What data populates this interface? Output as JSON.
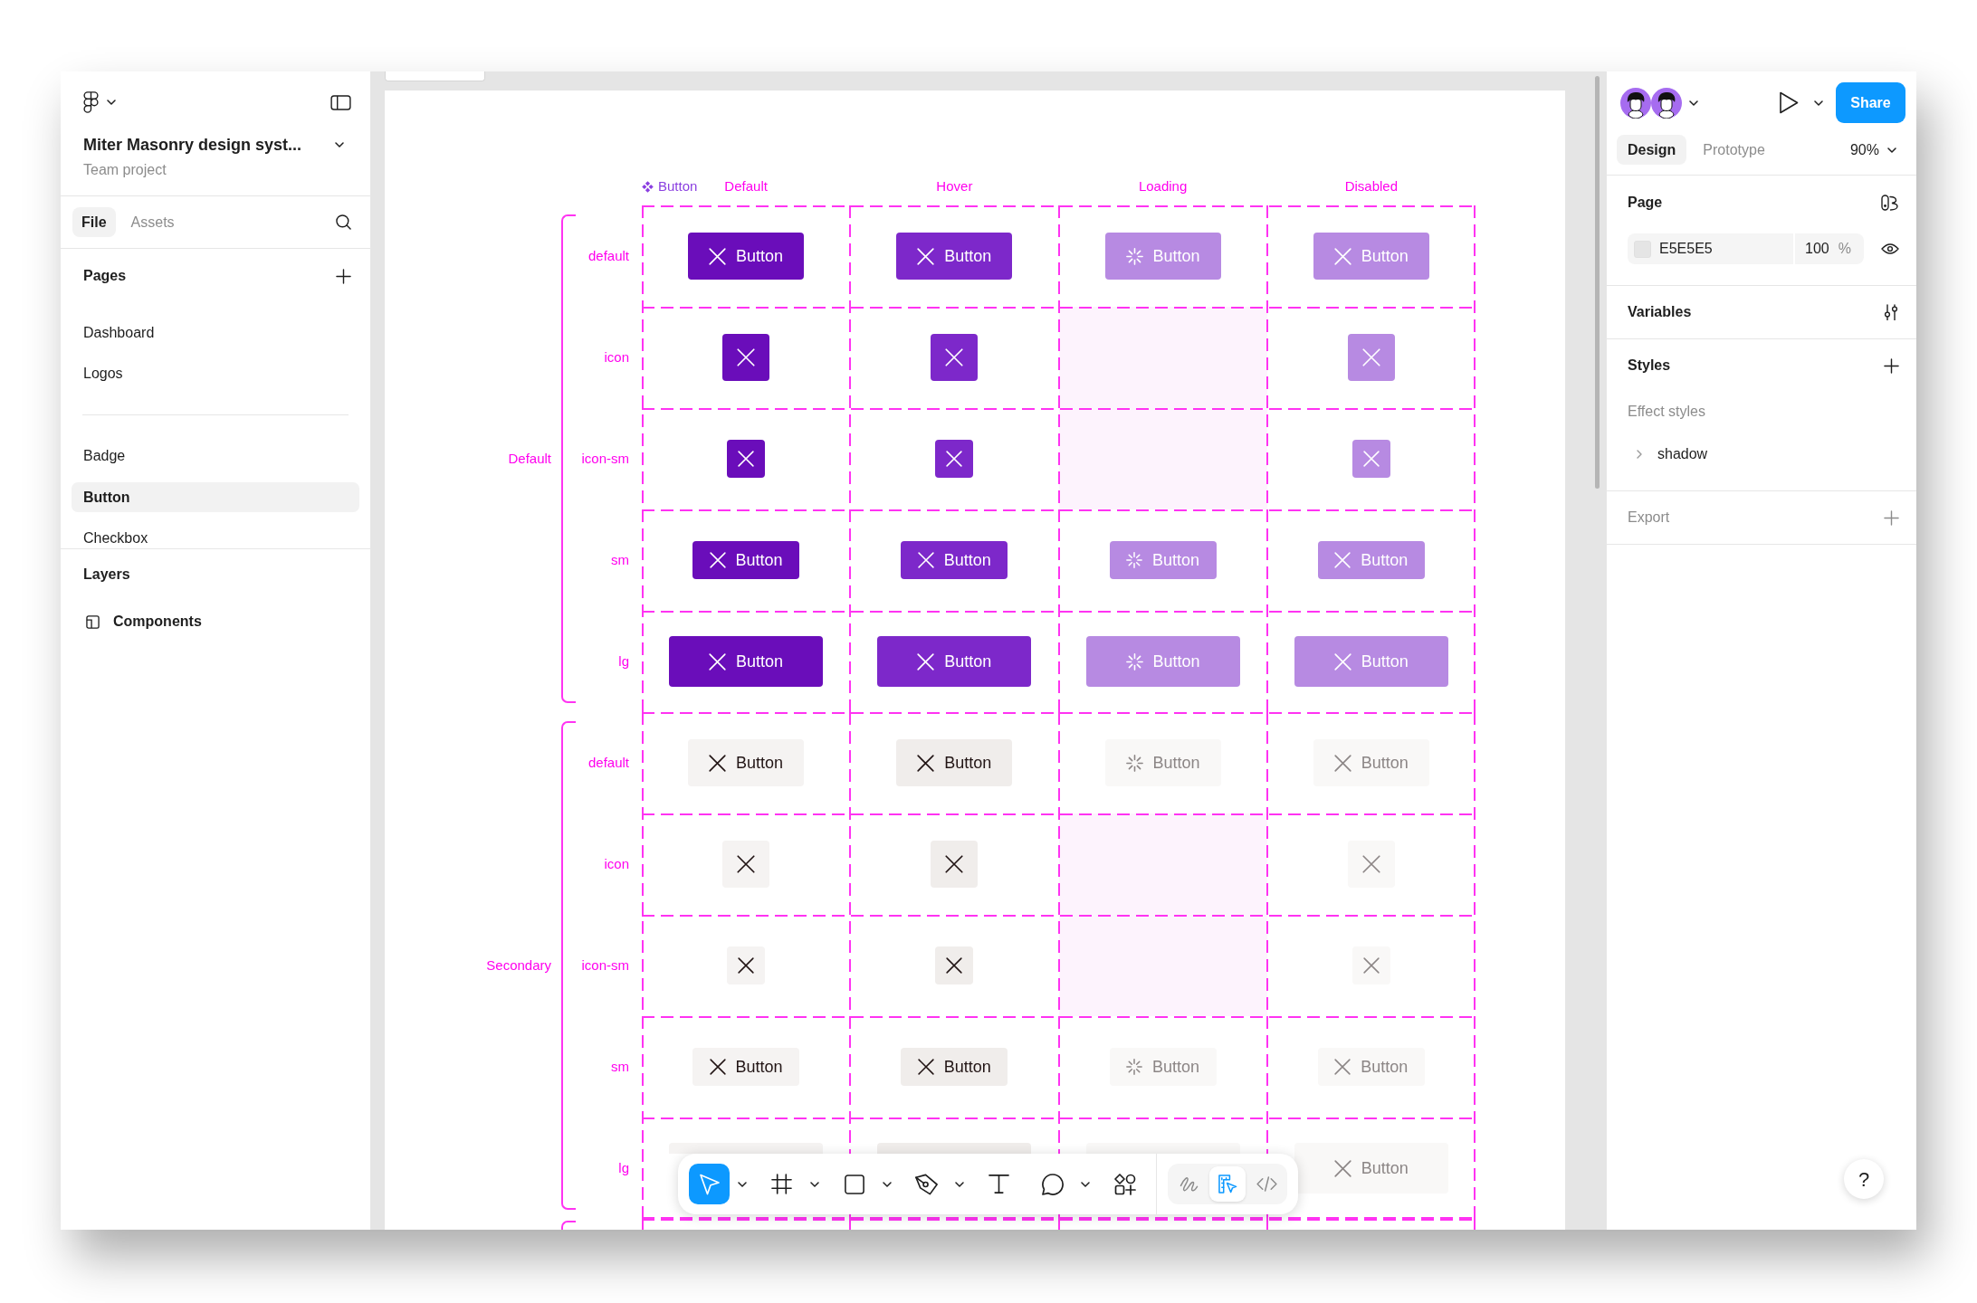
{
  "sidebar": {
    "title": "Miter Masonry design syst...",
    "subtitle": "Team project",
    "tabs": [
      {
        "label": "File",
        "selected": true
      },
      {
        "label": "Assets",
        "selected": false
      }
    ],
    "pages": {
      "title": "Pages",
      "items": [
        {
          "kind": "page",
          "label": "Dashboard",
          "selected": false
        },
        {
          "kind": "page",
          "label": "Logos",
          "selected": false
        },
        {
          "kind": "divider"
        },
        {
          "kind": "page",
          "label": "Badge",
          "selected": false
        },
        {
          "kind": "page",
          "label": "Button",
          "selected": true
        },
        {
          "kind": "page",
          "label": "Checkbox",
          "selected": false
        }
      ]
    },
    "layers": {
      "title": "Layers",
      "items": [
        {
          "label": "Components"
        }
      ]
    }
  },
  "canvas": {
    "component_label": "Button",
    "columns": [
      "Default",
      "Hover",
      "Loading",
      "Disabled"
    ],
    "groups": [
      {
        "label": "Default",
        "kind": "primary",
        "rows": [
          {
            "label": "default",
            "kind": "md",
            "cells": [
              {
                "kind": "default",
                "label": "Button"
              },
              {
                "kind": "hover",
                "label": "Button"
              },
              {
                "kind": "loading",
                "label": "Button"
              },
              {
                "kind": "disabled",
                "label": "Button"
              }
            ]
          },
          {
            "label": "icon",
            "kind": "icon",
            "cells": [
              {
                "kind": "default"
              },
              {
                "kind": "hover"
              },
              {
                "kind": "empty"
              },
              {
                "kind": "disabled"
              }
            ]
          },
          {
            "label": "icon-sm",
            "kind": "iconsm",
            "cells": [
              {
                "kind": "default"
              },
              {
                "kind": "hover"
              },
              {
                "kind": "empty"
              },
              {
                "kind": "disabled"
              }
            ]
          },
          {
            "label": "sm",
            "kind": "sm",
            "cells": [
              {
                "kind": "default",
                "label": "Button"
              },
              {
                "kind": "hover",
                "label": "Button"
              },
              {
                "kind": "loading",
                "label": "Button"
              },
              {
                "kind": "disabled",
                "label": "Button"
              }
            ]
          },
          {
            "label": "lg",
            "kind": "lg",
            "cells": [
              {
                "kind": "default",
                "label": "Button"
              },
              {
                "kind": "hover",
                "label": "Button"
              },
              {
                "kind": "loading",
                "label": "Button"
              },
              {
                "kind": "disabled",
                "label": "Button"
              }
            ]
          }
        ]
      },
      {
        "label": "Secondary",
        "kind": "secondary",
        "rows": [
          {
            "label": "default",
            "kind": "md",
            "cells": [
              {
                "kind": "default",
                "label": "Button"
              },
              {
                "kind": "hover",
                "label": "Button"
              },
              {
                "kind": "loading",
                "label": "Button"
              },
              {
                "kind": "disabled",
                "label": "Button"
              }
            ]
          },
          {
            "label": "icon",
            "kind": "icon",
            "cells": [
              {
                "kind": "default"
              },
              {
                "kind": "hover"
              },
              {
                "kind": "empty"
              },
              {
                "kind": "disabled"
              }
            ]
          },
          {
            "label": "icon-sm",
            "kind": "iconsm",
            "cells": [
              {
                "kind": "default"
              },
              {
                "kind": "hover"
              },
              {
                "kind": "empty"
              },
              {
                "kind": "disabled"
              }
            ]
          },
          {
            "label": "sm",
            "kind": "sm",
            "cells": [
              {
                "kind": "default",
                "label": "Button"
              },
              {
                "kind": "hover",
                "label": "Button"
              },
              {
                "kind": "loading",
                "label": "Button"
              },
              {
                "kind": "disabled",
                "label": "Button"
              }
            ]
          },
          {
            "label": "lg",
            "kind": "lg",
            "cells": [
              {
                "kind": "default"
              },
              {
                "kind": "hover"
              },
              {
                "kind": "loading"
              },
              {
                "kind": "disabled",
                "label": "Button"
              }
            ]
          }
        ]
      }
    ]
  },
  "toolbar": {
    "tools": [
      {
        "kind": "select",
        "selected": true,
        "dropdown": true
      },
      {
        "kind": "frame",
        "selected": false,
        "dropdown": true
      },
      {
        "kind": "rectangle",
        "selected": false,
        "dropdown": true
      },
      {
        "kind": "pen",
        "selected": false,
        "dropdown": true
      },
      {
        "kind": "text",
        "selected": false,
        "dropdown": false
      },
      {
        "kind": "comment",
        "selected": false,
        "dropdown": true
      },
      {
        "kind": "actions",
        "selected": false,
        "dropdown": false
      }
    ],
    "modes": [
      {
        "kind": "draw",
        "selected": false
      },
      {
        "kind": "design",
        "selected": true
      },
      {
        "kind": "dev",
        "selected": false
      }
    ]
  },
  "right_panel": {
    "share": "Share",
    "tabs": [
      {
        "label": "Design",
        "selected": true
      },
      {
        "label": "Prototype",
        "selected": false
      }
    ],
    "zoom": "90%",
    "page": {
      "title": "Page",
      "color": "E5E5E5",
      "opacity": "100",
      "unit": "%"
    },
    "sections": [
      {
        "kind": "variables",
        "title": "Variables",
        "disabled": false
      },
      {
        "kind": "styles",
        "title": "Styles",
        "disabled": false,
        "subheading": "Effect styles",
        "items": [
          {
            "label": "shadow",
            "expanded": false
          }
        ]
      },
      {
        "kind": "export",
        "title": "Export",
        "disabled": true
      }
    ]
  },
  "help_button": "?"
}
